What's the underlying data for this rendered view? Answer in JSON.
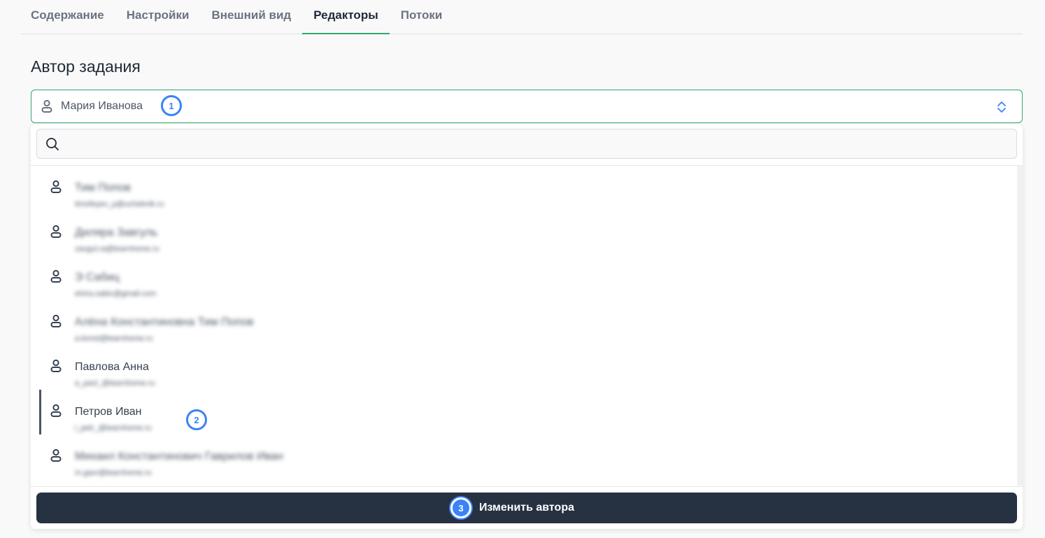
{
  "tabs": [
    {
      "label": "Содержание",
      "active": false
    },
    {
      "label": "Настройки",
      "active": false
    },
    {
      "label": "Внешний вид",
      "active": false
    },
    {
      "label": "Редакторы",
      "active": true
    },
    {
      "label": "Потоки",
      "active": false
    }
  ],
  "section": {
    "title": "Автор задания"
  },
  "author_select": {
    "value": "Мария Иванова",
    "icon": "person-icon",
    "chevron_icon": "chevron-up-down-icon",
    "accent_color": "#2fa86a"
  },
  "search": {
    "placeholder": "",
    "value": "",
    "icon": "search-icon"
  },
  "users": [
    {
      "name": "Тим Попов",
      "email": "timofeyev_p@uchebnik.ru",
      "blurred": true,
      "selected": false
    },
    {
      "name": "Диляра Завгуль",
      "email": "zavgul.ra@learnhome.ru",
      "blurred": true,
      "selected": false
    },
    {
      "name": "Э Сабиц",
      "email": "elvira.sabic@gmail.com",
      "blurred": true,
      "selected": false
    },
    {
      "name": "Алёна Константиновна Тим Попов",
      "email": "a.konst@learnhome.ru",
      "blurred": true,
      "selected": false
    },
    {
      "name": "Павлова Анна",
      "email": "a_pavl_@learnhome.ru",
      "blurred": true,
      "selected": false
    },
    {
      "name": "Петров Иван",
      "email": "i_petr_@learnhome.ru",
      "blurred": true,
      "selected": true
    },
    {
      "name": "Михаил Константинович Гаврилов Иван",
      "email": "m.gavr@learnhome.ru",
      "blurred": true,
      "selected": false
    }
  ],
  "action": {
    "label": "Изменить автора",
    "color": "#263142"
  },
  "annotations": [
    {
      "number": "1"
    },
    {
      "number": "2"
    },
    {
      "number": "3"
    }
  ]
}
